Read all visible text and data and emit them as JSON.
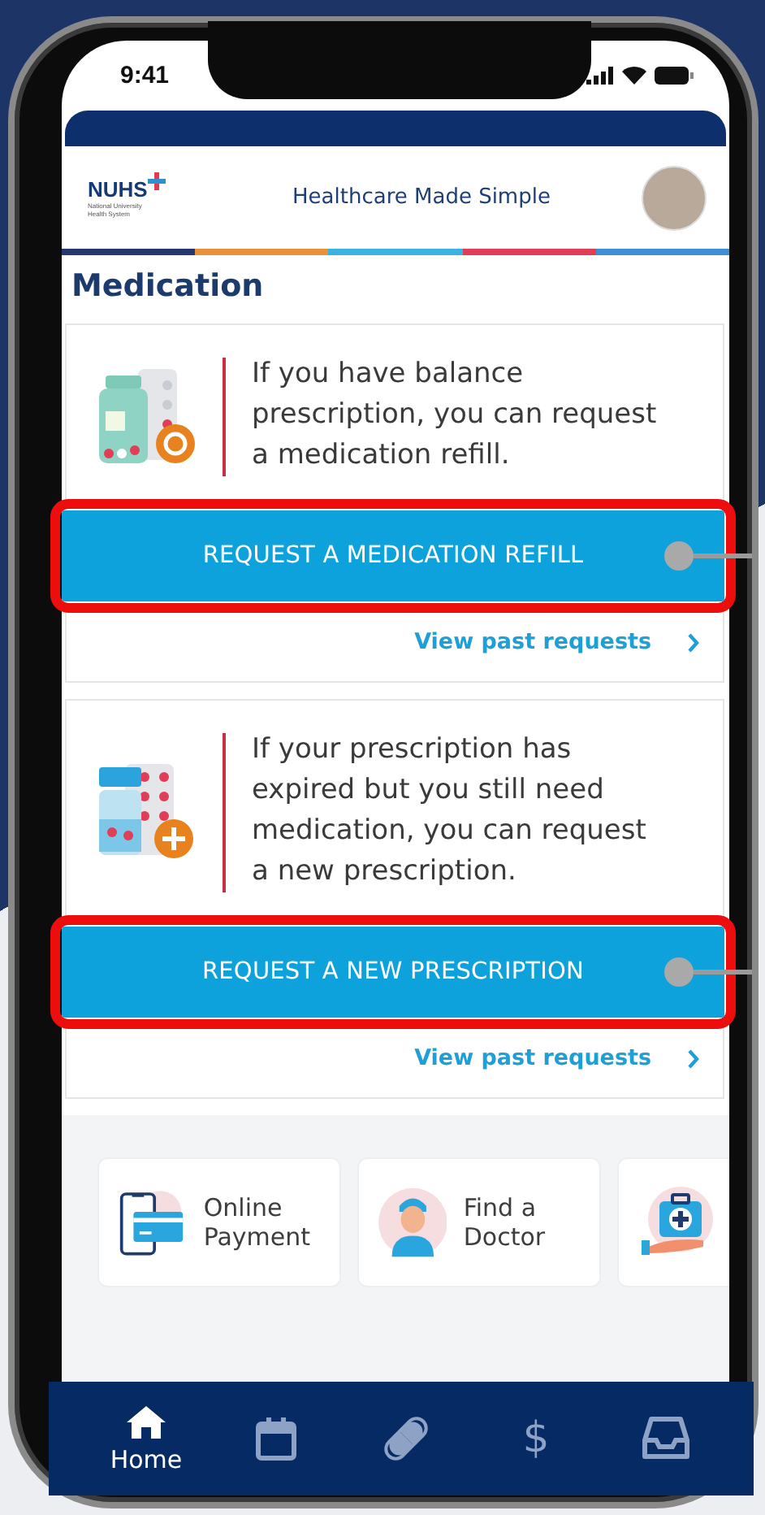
{
  "status_bar": {
    "time": "9:41"
  },
  "header": {
    "logo": {
      "name": "NUHS",
      "subtitle": "National University Health System"
    },
    "tagline": "Healthcare Made Simple"
  },
  "page_title": "Medication",
  "cards": [
    {
      "kind": "refill",
      "description": "If you have balance prescription, you can request a medication refill.",
      "button": {
        "label": "REQUEST A MEDICATION REFILL",
        "highlighted": true
      },
      "link": {
        "label": "View past requests"
      }
    },
    {
      "kind": "new",
      "description": "If your prescription has expired but you still need medication, you can request a new prescription.",
      "button": {
        "label": "REQUEST A NEW PRESCRIPTION",
        "highlighted": true
      },
      "link": {
        "label": "View past requests"
      }
    }
  ],
  "quick_links": [
    {
      "kind": "payment",
      "label": "Online Payment"
    },
    {
      "kind": "doctor",
      "label": "Find a Doctor"
    },
    {
      "kind": "first-aid"
    }
  ],
  "bottom_nav": [
    {
      "kind": "home",
      "label": "Home",
      "selected": true
    },
    {
      "kind": "calendar",
      "selected": false
    },
    {
      "kind": "pill",
      "selected": false
    },
    {
      "kind": "dollar",
      "glyph": "$",
      "selected": false
    },
    {
      "kind": "inbox",
      "selected": false
    }
  ]
}
